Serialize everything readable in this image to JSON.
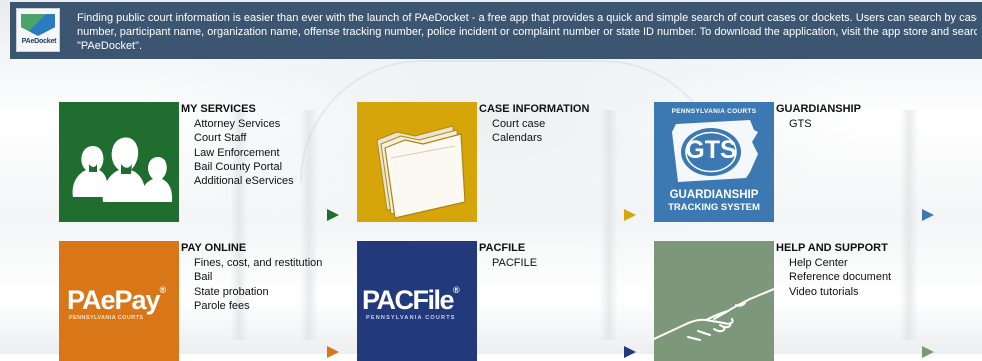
{
  "banner": {
    "logo_text": "PAeDocket",
    "lines": [
      "Finding public court information is easier than ever with the launch of PAeDocket - a free app that provides a quick and simple search of court cases or dockets. Users can search by case",
      "number, participant name, organization name, offense tracking number, police incident or complaint number or state ID number. To download the application, visit the app store and search for",
      "\"PAeDocket\"."
    ]
  },
  "sections": {
    "my_services": {
      "title": "MY SERVICES",
      "links": [
        "Attorney Services",
        "Court Staff",
        "Law Enforcement",
        "Bail County Portal",
        "Additional eServices"
      ]
    },
    "case_information": {
      "title": "CASE INFORMATION",
      "links": [
        "Court case",
        "Calendars"
      ]
    },
    "guardianship": {
      "title": "GUARDIANSHIP",
      "links": [
        "GTS"
      ],
      "logo": {
        "top": "PENNSYLVANIA COURTS",
        "badge": "GTS",
        "line1": "GUARDIANSHIP",
        "line2": "TRACKING SYSTEM"
      }
    },
    "pay_online": {
      "title": "PAY ONLINE",
      "links": [
        "Fines, cost, and restitution",
        "Bail",
        "State probation",
        "Parole fees"
      ],
      "logo": {
        "main": "PAePay",
        "reg": "®",
        "sub": "PENNSYLVANIA COURTS"
      }
    },
    "pacfile": {
      "title": "PACFILE",
      "links": [
        "PACFILE"
      ],
      "logo": {
        "main": "PACFile",
        "reg": "®",
        "sub": "PENNSYLVANIA COURTS"
      }
    },
    "help_support": {
      "title": "HELP AND SUPPORT",
      "links": [
        "Help Center",
        "Reference document",
        "Video tutorials"
      ]
    }
  },
  "colors": {
    "banner": "#3c5570",
    "my_services": "#1f6e2f",
    "case_information": "#d5a509",
    "guardianship": "#3c79b3",
    "pay_online": "#d87618",
    "pacfile": "#223a7c",
    "help_support": "#7d977a"
  },
  "icons": {
    "my_services": "people-silhouettes-icon",
    "case_information": "file-folder-icon",
    "help_support": "handshake-icon",
    "arrow": "play-arrow-icon"
  }
}
